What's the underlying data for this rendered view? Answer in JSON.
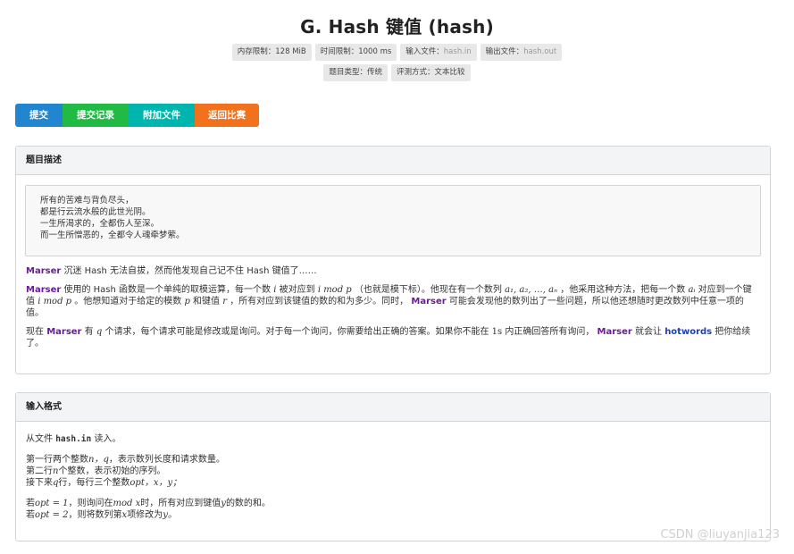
{
  "title": "G. Hash 键值 (hash)",
  "info_row1": [
    {
      "key": "内存限制：",
      "value": "128 MiB"
    },
    {
      "key": "时间限制：",
      "value": "1000 ms"
    },
    {
      "key": "输入文件：",
      "value": "hash.in"
    },
    {
      "key": "输出文件：",
      "value": "hash.out"
    }
  ],
  "info_row2": [
    {
      "key": "题目类型：",
      "value": "传统"
    },
    {
      "key": "评测方式：",
      "value": "文本比较"
    }
  ],
  "buttons": {
    "submit": "提交",
    "records": "提交记录",
    "files": "附加文件",
    "back": "返回比赛"
  },
  "colors": {
    "submit": "#2185d0",
    "records": "#21ba45",
    "files": "#00b5ad",
    "back": "#f2711c",
    "highlight": "#6a1b9a"
  },
  "description": {
    "heading": "题目描述",
    "poem": [
      "所有的苦难与背负尽头，",
      "都是行云流水般的此世光阴。",
      "一生所渴求的，全都伤人至深。",
      "而一生所憎恶的，全都令人魂牵梦萦。"
    ],
    "marser": "Marser",
    "hotwords": "hotwords",
    "p1_text": "沉迷 Hash 无法自拔，然而他发现自己记不住 Hash 键值了……",
    "p2_a": "使用的 Hash 函数是一个单纯的取模运算，每一个数",
    "p2_b": "被对应到",
    "p2_c": "（也就是模下标）。他现在有一个数列",
    "p2_d": "，他采用这种方法，把每一个数",
    "p2_e": "对应到一个键值",
    "p2_f": "。他想知道对于给定的模数",
    "p2_g": "和键值",
    "p2_h": "，所有对应到该键值的数的和为多少。同时，",
    "p2_i": "可能会发现他的数列出了一些问题，所以他还想随时更改数列中任意一项的值。",
    "p3_a": "现在",
    "p3_b": "有",
    "p3_c": "个请求，每个请求可能是修改或是询问。对于每一个询问，你需要给出正确的答案。如果你不能在",
    "p3_d": "内正确回答所有询问，",
    "p3_e": "就会让",
    "p3_f": "把你给续了。"
  },
  "input": {
    "heading": "输入格式",
    "l1_a": "从文件",
    "l1_file": "hash.in",
    "l1_b": "读入。",
    "l2_a": "第一行两个整数",
    "l2_b": "，表示数列长度和请求数量。",
    "l3_a": "第二行",
    "l3_b": "个整数，表示初始的序列。",
    "l4_a": "接下来",
    "l4_b": "行，每行三个整数",
    "l5_a": "若",
    "l5_b": "，则询问在",
    "l5_c": "时，所有对应到键值",
    "l5_d": "的数的和。",
    "l6_a": "若",
    "l6_b": "，则将数列第",
    "l6_c": "项修改为"
  },
  "math": {
    "i": "i",
    "imodp": "i mod p",
    "seq": "a₁, a₂, …, aₙ",
    "ai": "aᵢ",
    "p": "p",
    "r": "r",
    "q": "q",
    "one_s": "1s",
    "nq": "n，q",
    "n": "n",
    "optxy": "opt，x，y；",
    "opt1": "opt = 1",
    "modx": "mod x",
    "y": "y",
    "opt2": "opt = 2",
    "x": "x",
    "y_end": "y。"
  },
  "watermark": "CSDN @liuyanjia123"
}
